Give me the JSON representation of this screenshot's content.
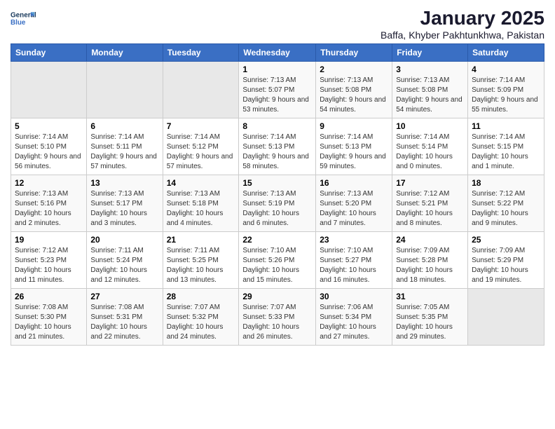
{
  "header": {
    "logo_text_general": "General",
    "logo_text_blue": "Blue",
    "month_title": "January 2025",
    "subtitle": "Baffa, Khyber Pakhtunkhwa, Pakistan"
  },
  "days_of_week": [
    "Sunday",
    "Monday",
    "Tuesday",
    "Wednesday",
    "Thursday",
    "Friday",
    "Saturday"
  ],
  "weeks": [
    [
      {
        "day": "",
        "sunrise": "",
        "sunset": "",
        "daylight": ""
      },
      {
        "day": "",
        "sunrise": "",
        "sunset": "",
        "daylight": ""
      },
      {
        "day": "",
        "sunrise": "",
        "sunset": "",
        "daylight": ""
      },
      {
        "day": "1",
        "sunrise": "Sunrise: 7:13 AM",
        "sunset": "Sunset: 5:07 PM",
        "daylight": "Daylight: 9 hours and 53 minutes."
      },
      {
        "day": "2",
        "sunrise": "Sunrise: 7:13 AM",
        "sunset": "Sunset: 5:08 PM",
        "daylight": "Daylight: 9 hours and 54 minutes."
      },
      {
        "day": "3",
        "sunrise": "Sunrise: 7:13 AM",
        "sunset": "Sunset: 5:08 PM",
        "daylight": "Daylight: 9 hours and 54 minutes."
      },
      {
        "day": "4",
        "sunrise": "Sunrise: 7:14 AM",
        "sunset": "Sunset: 5:09 PM",
        "daylight": "Daylight: 9 hours and 55 minutes."
      }
    ],
    [
      {
        "day": "5",
        "sunrise": "Sunrise: 7:14 AM",
        "sunset": "Sunset: 5:10 PM",
        "daylight": "Daylight: 9 hours and 56 minutes."
      },
      {
        "day": "6",
        "sunrise": "Sunrise: 7:14 AM",
        "sunset": "Sunset: 5:11 PM",
        "daylight": "Daylight: 9 hours and 57 minutes."
      },
      {
        "day": "7",
        "sunrise": "Sunrise: 7:14 AM",
        "sunset": "Sunset: 5:12 PM",
        "daylight": "Daylight: 9 hours and 57 minutes."
      },
      {
        "day": "8",
        "sunrise": "Sunrise: 7:14 AM",
        "sunset": "Sunset: 5:13 PM",
        "daylight": "Daylight: 9 hours and 58 minutes."
      },
      {
        "day": "9",
        "sunrise": "Sunrise: 7:14 AM",
        "sunset": "Sunset: 5:13 PM",
        "daylight": "Daylight: 9 hours and 59 minutes."
      },
      {
        "day": "10",
        "sunrise": "Sunrise: 7:14 AM",
        "sunset": "Sunset: 5:14 PM",
        "daylight": "Daylight: 10 hours and 0 minutes."
      },
      {
        "day": "11",
        "sunrise": "Sunrise: 7:14 AM",
        "sunset": "Sunset: 5:15 PM",
        "daylight": "Daylight: 10 hours and 1 minute."
      }
    ],
    [
      {
        "day": "12",
        "sunrise": "Sunrise: 7:13 AM",
        "sunset": "Sunset: 5:16 PM",
        "daylight": "Daylight: 10 hours and 2 minutes."
      },
      {
        "day": "13",
        "sunrise": "Sunrise: 7:13 AM",
        "sunset": "Sunset: 5:17 PM",
        "daylight": "Daylight: 10 hours and 3 minutes."
      },
      {
        "day": "14",
        "sunrise": "Sunrise: 7:13 AM",
        "sunset": "Sunset: 5:18 PM",
        "daylight": "Daylight: 10 hours and 4 minutes."
      },
      {
        "day": "15",
        "sunrise": "Sunrise: 7:13 AM",
        "sunset": "Sunset: 5:19 PM",
        "daylight": "Daylight: 10 hours and 6 minutes."
      },
      {
        "day": "16",
        "sunrise": "Sunrise: 7:13 AM",
        "sunset": "Sunset: 5:20 PM",
        "daylight": "Daylight: 10 hours and 7 minutes."
      },
      {
        "day": "17",
        "sunrise": "Sunrise: 7:12 AM",
        "sunset": "Sunset: 5:21 PM",
        "daylight": "Daylight: 10 hours and 8 minutes."
      },
      {
        "day": "18",
        "sunrise": "Sunrise: 7:12 AM",
        "sunset": "Sunset: 5:22 PM",
        "daylight": "Daylight: 10 hours and 9 minutes."
      }
    ],
    [
      {
        "day": "19",
        "sunrise": "Sunrise: 7:12 AM",
        "sunset": "Sunset: 5:23 PM",
        "daylight": "Daylight: 10 hours and 11 minutes."
      },
      {
        "day": "20",
        "sunrise": "Sunrise: 7:11 AM",
        "sunset": "Sunset: 5:24 PM",
        "daylight": "Daylight: 10 hours and 12 minutes."
      },
      {
        "day": "21",
        "sunrise": "Sunrise: 7:11 AM",
        "sunset": "Sunset: 5:25 PM",
        "daylight": "Daylight: 10 hours and 13 minutes."
      },
      {
        "day": "22",
        "sunrise": "Sunrise: 7:10 AM",
        "sunset": "Sunset: 5:26 PM",
        "daylight": "Daylight: 10 hours and 15 minutes."
      },
      {
        "day": "23",
        "sunrise": "Sunrise: 7:10 AM",
        "sunset": "Sunset: 5:27 PM",
        "daylight": "Daylight: 10 hours and 16 minutes."
      },
      {
        "day": "24",
        "sunrise": "Sunrise: 7:09 AM",
        "sunset": "Sunset: 5:28 PM",
        "daylight": "Daylight: 10 hours and 18 minutes."
      },
      {
        "day": "25",
        "sunrise": "Sunrise: 7:09 AM",
        "sunset": "Sunset: 5:29 PM",
        "daylight": "Daylight: 10 hours and 19 minutes."
      }
    ],
    [
      {
        "day": "26",
        "sunrise": "Sunrise: 7:08 AM",
        "sunset": "Sunset: 5:30 PM",
        "daylight": "Daylight: 10 hours and 21 minutes."
      },
      {
        "day": "27",
        "sunrise": "Sunrise: 7:08 AM",
        "sunset": "Sunset: 5:31 PM",
        "daylight": "Daylight: 10 hours and 22 minutes."
      },
      {
        "day": "28",
        "sunrise": "Sunrise: 7:07 AM",
        "sunset": "Sunset: 5:32 PM",
        "daylight": "Daylight: 10 hours and 24 minutes."
      },
      {
        "day": "29",
        "sunrise": "Sunrise: 7:07 AM",
        "sunset": "Sunset: 5:33 PM",
        "daylight": "Daylight: 10 hours and 26 minutes."
      },
      {
        "day": "30",
        "sunrise": "Sunrise: 7:06 AM",
        "sunset": "Sunset: 5:34 PM",
        "daylight": "Daylight: 10 hours and 27 minutes."
      },
      {
        "day": "31",
        "sunrise": "Sunrise: 7:05 AM",
        "sunset": "Sunset: 5:35 PM",
        "daylight": "Daylight: 10 hours and 29 minutes."
      },
      {
        "day": "",
        "sunrise": "",
        "sunset": "",
        "daylight": ""
      }
    ]
  ]
}
